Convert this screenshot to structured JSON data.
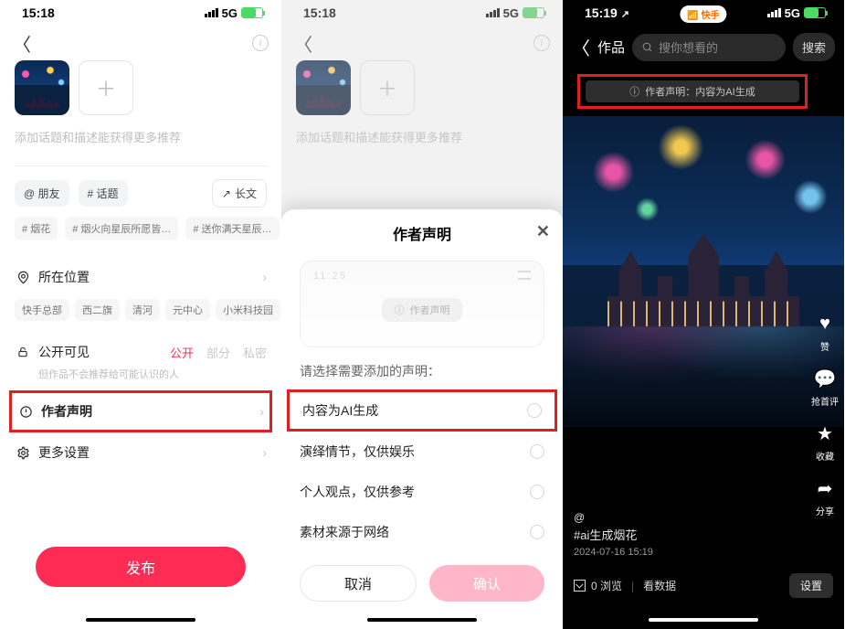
{
  "status": {
    "time1": "15:18",
    "time2": "15:18",
    "time3": "15:19",
    "net": "5G",
    "arrow": "↗"
  },
  "p1": {
    "hint": "添加话题和描述能获得更多推荐",
    "chip_friend": "@ 朋友",
    "chip_topic": "# 话题",
    "chip_long": "长文",
    "chip_long_icon": "↗",
    "tag1": "# 烟花",
    "tag2": "# 烟火向星辰所愿皆…",
    "tag3": "# 送你满天星辰…",
    "tag4": "# ",
    "loc_label": "所在位置",
    "loc1": "快手总部",
    "loc2": "西二旗",
    "loc3": "清河",
    "loc4": "元中心",
    "loc5": "小米科技园",
    "vis_label": "公开可见",
    "vis_pub": "公开",
    "vis_part": "部分",
    "vis_priv": "私密",
    "vis_sub": "但作品不会推荐给可能认识的人",
    "author_label": "作者声明",
    "more_label": "更多设置",
    "publish": "发布"
  },
  "p2": {
    "hint": "添加话题和描述能获得更多推荐",
    "sheet_title": "作者声明",
    "illus_text": "作者声明",
    "illus_time": "11:25",
    "select_label": "请选择需要添加的声明：",
    "opt_ai": "内容为AI生成",
    "opt_drama": "演绎情节，仅供娱乐",
    "opt_view": "个人观点，仅供参考",
    "opt_net": "素材来源于网络",
    "cancel": "取消",
    "ok": "确认"
  },
  "p3": {
    "nav_title": "作品",
    "search_ph": "搜你想看的",
    "search_btn": "搜索",
    "ks_badge": "快手",
    "banner": "作者声明：内容为AI生成",
    "like": "赞",
    "cmt": "抢首评",
    "fav": "收藏",
    "share": "分享",
    "at": "@",
    "hashtag": "#ai生成烟花",
    "timestamp": "2024-07-16 15:19",
    "views_n": "0 浏览",
    "stats": "看数据",
    "settings": "设置"
  }
}
